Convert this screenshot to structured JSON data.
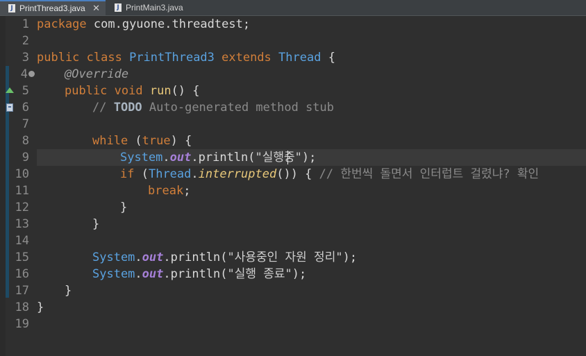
{
  "tabs": [
    {
      "label": "PrintThread3.java",
      "icon": "java-file-icon",
      "active": true,
      "close": "✕"
    },
    {
      "label": "PrintMain3.java",
      "icon": "java-file-icon",
      "active": false
    }
  ],
  "file_icon_glyph": "J",
  "line_numbers": [
    "1",
    "2",
    "3",
    "4",
    "5",
    "6",
    "7",
    "8",
    "9",
    "10",
    "11",
    "12",
    "13",
    "14",
    "15",
    "16",
    "17",
    "18",
    "19"
  ],
  "code": {
    "l1_kw": "package",
    "l1_rest": " com.gyuone.threadtest;",
    "l3_kw1": "public",
    "l3_kw2": " class",
    "l3_name": " PrintThread3",
    "l3_kw3": " extends",
    "l3_super": " Thread",
    "l3_brace": " {",
    "l4_ann": "@Override",
    "l5_kw1": "public",
    "l5_kw2": " void",
    "l5_method": " run",
    "l5_rest": "() {",
    "l6_cmt1": "// ",
    "l6_todo": "TODO",
    "l6_cmt2": " Auto-generated method stub",
    "l8_kw": "while",
    "l8_rest1": " (",
    "l8_true": "true",
    "l8_rest2": ") {",
    "l9_sys": "System",
    "l9_dot": ".",
    "l9_out": "out",
    "l9_call": ".println(",
    "l9_str": "\"실행중\"",
    "l9_end": ");",
    "l10_kw": "if",
    "l10_rest1": " (",
    "l10_thread": "Thread",
    "l10_dot": ".",
    "l10_interrupted": "interrupted",
    "l10_rest2": "()) { ",
    "l10_cmt": "// 한번씩 돌면서 인터럽트 걸렸냐? 확인",
    "l11_kw": "break",
    "l11_rest": ";",
    "l12": "}",
    "l13": "}",
    "l15_sys": "System",
    "l15_dot": ".",
    "l15_out": "out",
    "l15_call": ".println(",
    "l15_str": "\"사용중인 자원 정리\"",
    "l15_end": ");",
    "l16_sys": "System",
    "l16_dot": ".",
    "l16_out": "out",
    "l16_call": ".println(",
    "l16_str": "\"실행 종료\"",
    "l16_end": ");",
    "l17": "}",
    "l18": "}"
  },
  "colors": {
    "background": "#2f2f2f",
    "keyword": "#d27f3a",
    "type": "#5aa2e0",
    "field": "#a680d8",
    "comment": "#8a8a8a",
    "current_line": "#3a3a3a",
    "tab_accent": "#4a7fc0"
  }
}
